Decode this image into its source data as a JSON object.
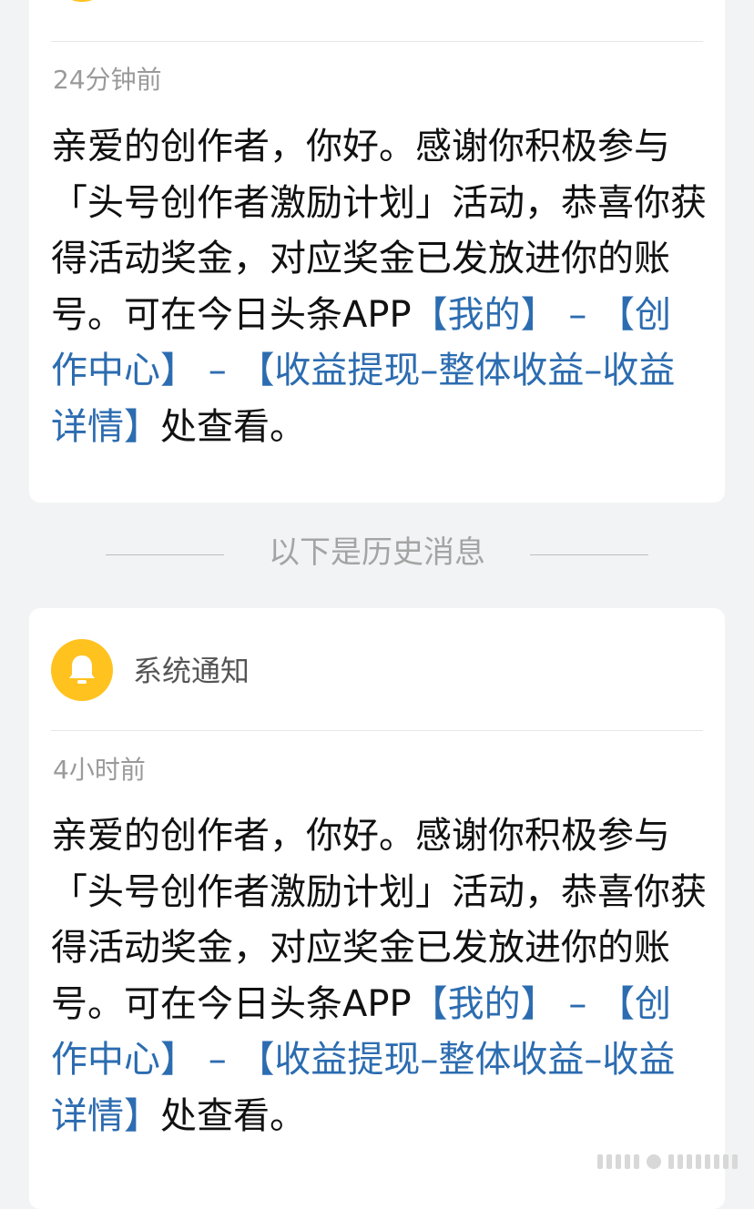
{
  "history_divider": "以下是历史消息",
  "notifications": [
    {
      "sender": "",
      "time": "24分钟前",
      "message": {
        "intro": "亲爱的创作者，你好。感谢你积极参与「头号创作者激励计划」活动，恭喜你获得活动奖金，对应奖金已发放进你的账号。可在今日头条APP",
        "link_1": "【我的】",
        "dash_1": " – ",
        "link_2": "【创作中心】",
        "dash_2": " – ",
        "link_3": "【收益提现–整体收益–收益详情】",
        "outro": "处查看。"
      }
    },
    {
      "sender": "系统通知",
      "time": "4小时前",
      "message": {
        "intro": "亲爱的创作者，你好。感谢你积极参与「头号创作者激励计划」活动，恭喜你获得活动奖金，对应奖金已发放进你的账号。可在今日头条APP",
        "link_1": "【我的】",
        "dash_1": " – ",
        "link_2": "【创作中心】",
        "dash_2": " – ",
        "link_3": "【收益提现–整体收益–收益详情】",
        "outro": "处查看。"
      }
    }
  ],
  "colors": {
    "background": "#f2f3f5",
    "card": "#ffffff",
    "avatar": "#ffc21f",
    "link": "#2c6cb0",
    "text": "#111111",
    "muted": "#9a9a9a"
  },
  "icons": {
    "avatar": "bell-icon"
  }
}
